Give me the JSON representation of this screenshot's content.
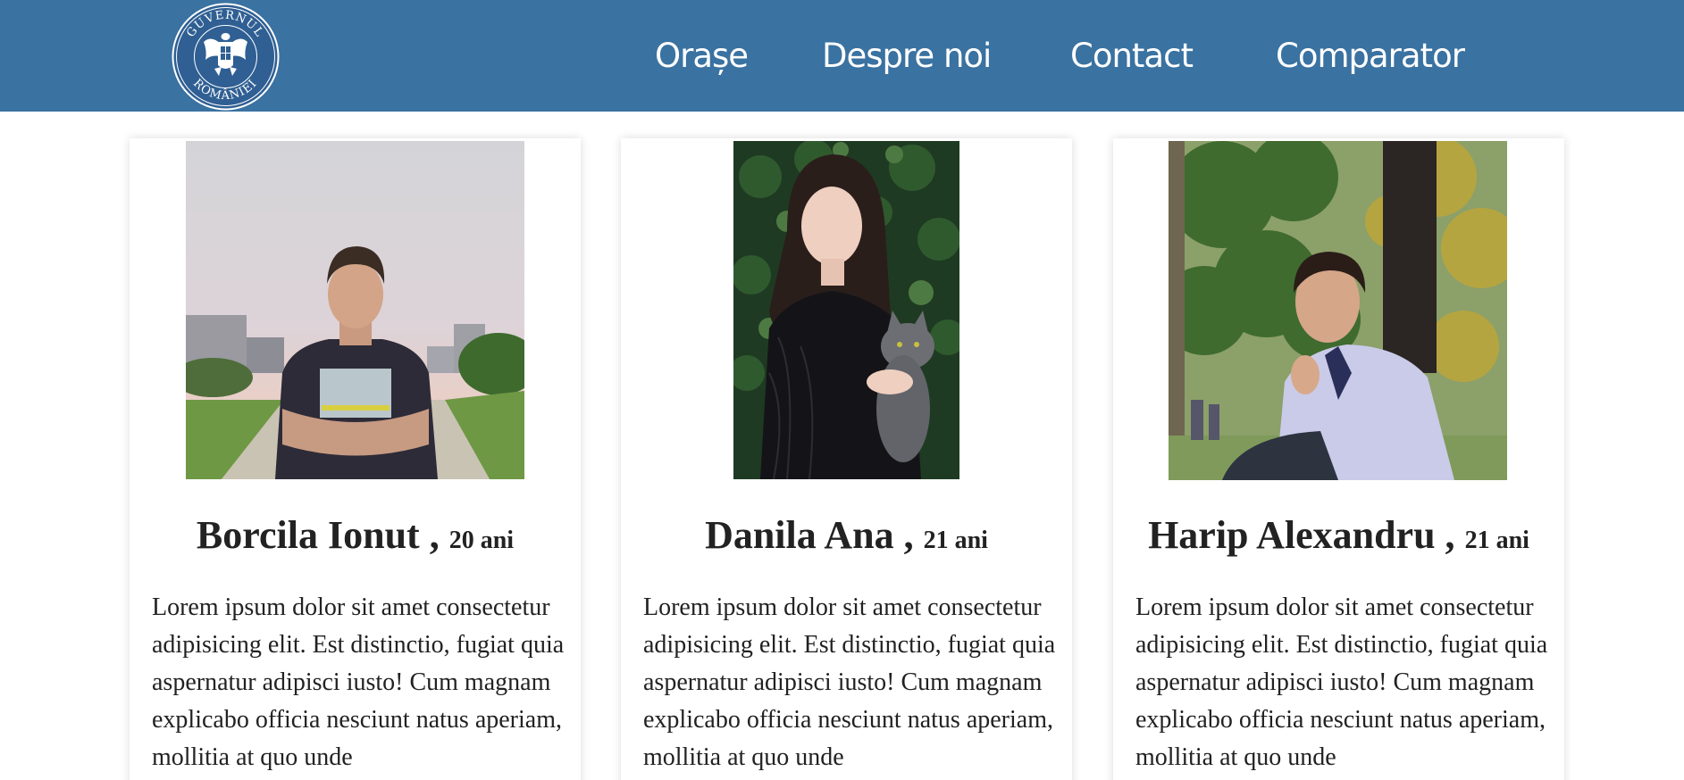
{
  "header": {
    "logo_text_top": "GUVERNUL",
    "logo_text_bottom": "ROMÂNIEI",
    "bg_color": "#3a72a1"
  },
  "nav": {
    "items": [
      {
        "label": "Orașe"
      },
      {
        "label": "Despre noi"
      },
      {
        "label": "Contact"
      },
      {
        "label": "Comparator"
      }
    ]
  },
  "cards": [
    {
      "name": "Borcila Ionut ,",
      "age": "20 ani",
      "bio": "Lorem ipsum dolor sit amet consectetur adipisicing elit. Est distinctio, fugiat quia aspernatur adipisci iusto! Cum magnam explicabo officia nesciunt natus aperiam, mollitia at quo unde"
    },
    {
      "name": "Danila Ana ,",
      "age": "21 ani",
      "bio": "Lorem ipsum dolor sit amet consectetur adipisicing elit. Est distinctio, fugiat quia aspernatur adipisci iusto! Cum magnam explicabo officia nesciunt natus aperiam, mollitia at quo unde"
    },
    {
      "name": "Harip Alexandru ,",
      "age": "21 ani",
      "bio": "Lorem ipsum dolor sit amet consectetur adipisicing elit. Est distinctio, fugiat quia aspernatur adipisci iusto! Cum magnam explicabo officia nesciunt natus aperiam, mollitia at quo unde"
    }
  ]
}
